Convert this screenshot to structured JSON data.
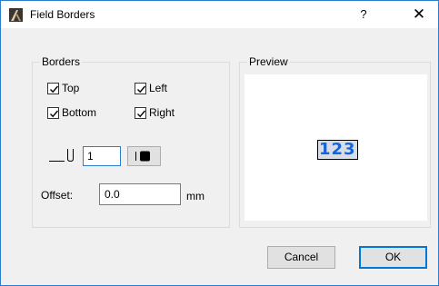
{
  "window": {
    "title": "Field Borders",
    "help_glyph": "?",
    "close_glyph": "✕",
    "icon": "archicad-app-icon",
    "frame_color": "#2b7cc9"
  },
  "borders": {
    "group_label": "Borders",
    "checkboxes": [
      {
        "label": "Top",
        "checked": true
      },
      {
        "label": "Left",
        "checked": true
      },
      {
        "label": "Bottom",
        "checked": true
      },
      {
        "label": "Right",
        "checked": true
      }
    ],
    "line_thickness_icon": "line-thickness-icon",
    "thickness_value": "1",
    "color_button_icon": "pen-color-icon",
    "offset_label": "Offset:",
    "offset_value": "0.0",
    "offset_unit": "mm"
  },
  "preview": {
    "group_label": "Preview",
    "sample_text": "123",
    "sample_color": "#1565d8"
  },
  "buttons": {
    "cancel_label": "Cancel",
    "ok_label": "OK"
  }
}
